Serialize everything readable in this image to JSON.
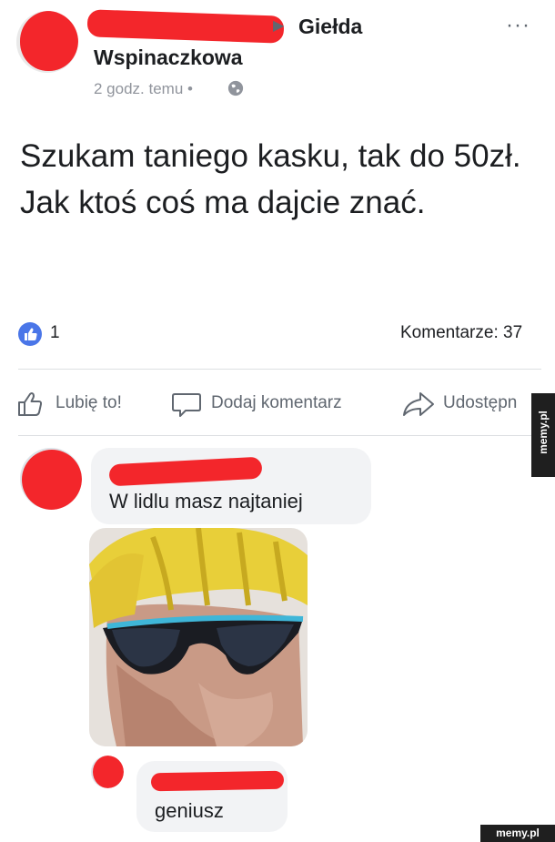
{
  "post": {
    "group_name_line1": "Giełda",
    "group_name_line2": "Wspinaczkowa",
    "timestamp": "2 godz. temu •",
    "text": "Szukam taniego kasku, tak do 50zł. Jak ktoś coś ma dajcie znać.",
    "more_label": "···"
  },
  "stats": {
    "likes": "1",
    "comments": "Komentarze: 37"
  },
  "actions": {
    "like": "Lubię to!",
    "comment": "Dodaj komentarz",
    "share": "Udostępn"
  },
  "comments": [
    {
      "text": "W lidlu masz najtaniej"
    },
    {
      "text": "geniusz"
    }
  ],
  "watermark": {
    "side": "memy.pl",
    "bottom": "memy.pl"
  },
  "icons": {
    "like_badge": "thumbs-up-icon",
    "globe": "globe-icon",
    "like": "thumbs-up-outline-icon",
    "comment": "speech-bubble-icon",
    "share": "share-arrow-icon"
  },
  "colors": {
    "redaction": "#f3262b",
    "like_badge": "#4a76e8",
    "muted_text": "#606770",
    "bubble": "#f2f3f5"
  }
}
